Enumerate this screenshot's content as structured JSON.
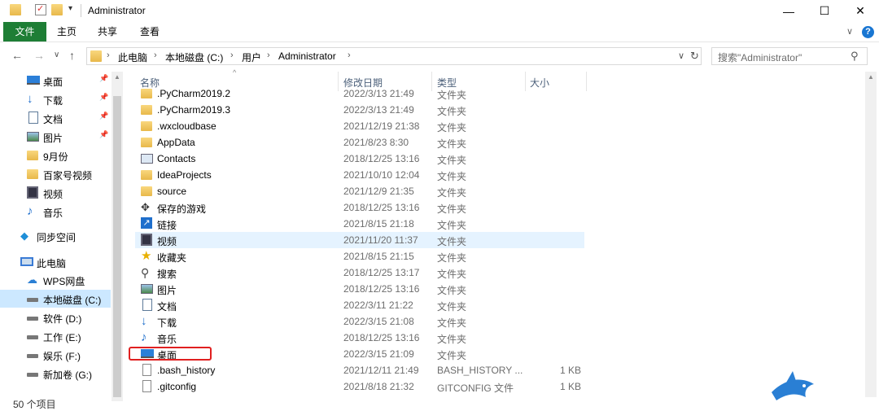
{
  "window": {
    "title": "Administrator"
  },
  "ribbon": {
    "tabs": [
      "文件",
      "主页",
      "共享",
      "查看"
    ]
  },
  "address": {
    "crumbs": [
      "此电脑",
      "本地磁盘 (C:)",
      "用户",
      "Administrator"
    ],
    "search_placeholder": "搜索\"Administrator\""
  },
  "nav": {
    "items": [
      {
        "label": "桌面",
        "icon": "desktop-icon",
        "pinned": true
      },
      {
        "label": "下载",
        "icon": "download-icon",
        "pinned": true
      },
      {
        "label": "文档",
        "icon": "document-icon",
        "pinned": true
      },
      {
        "label": "图片",
        "icon": "picture-icon",
        "pinned": true
      },
      {
        "label": "9月份",
        "icon": "folder-icon",
        "pinned": false
      },
      {
        "label": "百家号视频",
        "icon": "folder-icon",
        "pinned": false
      },
      {
        "label": "视频",
        "icon": "video-icon",
        "pinned": false
      },
      {
        "label": "音乐",
        "icon": "music-icon",
        "pinned": false
      },
      {
        "label": "同步空间",
        "icon": "sync-icon",
        "pinned": false
      },
      {
        "label": "此电脑",
        "icon": "computer-icon",
        "pinned": false
      },
      {
        "label": "WPS网盘",
        "icon": "cloud-icon",
        "pinned": false
      },
      {
        "label": "本地磁盘 (C:)",
        "icon": "drive-icon",
        "pinned": false,
        "selected": true
      },
      {
        "label": "软件 (D:)",
        "icon": "drive-icon",
        "pinned": false
      },
      {
        "label": "工作 (E:)",
        "icon": "drive-icon",
        "pinned": false
      },
      {
        "label": "娱乐 (F:)",
        "icon": "drive-icon",
        "pinned": false
      },
      {
        "label": "新加卷 (G:)",
        "icon": "drive-icon",
        "pinned": false
      }
    ]
  },
  "columns": {
    "name": "名称",
    "date": "修改日期",
    "type": "类型",
    "size": "大小"
  },
  "files": [
    {
      "name": ".PyCharm2019.2",
      "date": "2022/3/13 21:49",
      "type": "文件夹",
      "size": "",
      "icon": "folder-icon"
    },
    {
      "name": ".PyCharm2019.3",
      "date": "2022/3/13 21:49",
      "type": "文件夹",
      "size": "",
      "icon": "folder-icon"
    },
    {
      "name": ".wxcloudbase",
      "date": "2021/12/19 21:38",
      "type": "文件夹",
      "size": "",
      "icon": "folder-icon"
    },
    {
      "name": "AppData",
      "date": "2021/8/23 8:30",
      "type": "文件夹",
      "size": "",
      "icon": "folder-icon"
    },
    {
      "name": "Contacts",
      "date": "2018/12/25 13:16",
      "type": "文件夹",
      "size": "",
      "icon": "contacts-icon"
    },
    {
      "name": "IdeaProjects",
      "date": "2021/10/10 12:04",
      "type": "文件夹",
      "size": "",
      "icon": "folder-icon"
    },
    {
      "name": "source",
      "date": "2021/12/9 21:35",
      "type": "文件夹",
      "size": "",
      "icon": "folder-icon"
    },
    {
      "name": "保存的游戏",
      "date": "2018/12/25 13:16",
      "type": "文件夹",
      "size": "",
      "icon": "saved-games-icon"
    },
    {
      "name": "链接",
      "date": "2021/8/15 21:18",
      "type": "文件夹",
      "size": "",
      "icon": "links-icon"
    },
    {
      "name": "视频",
      "date": "2021/11/20 11:37",
      "type": "文件夹",
      "size": "",
      "icon": "video-icon"
    },
    {
      "name": "收藏夹",
      "date": "2021/8/15 21:15",
      "type": "文件夹",
      "size": "",
      "icon": "favorites-icon"
    },
    {
      "name": "搜索",
      "date": "2018/12/25 13:17",
      "type": "文件夹",
      "size": "",
      "icon": "search-icon"
    },
    {
      "name": "图片",
      "date": "2018/12/25 13:16",
      "type": "文件夹",
      "size": "",
      "icon": "picture-icon"
    },
    {
      "name": "文档",
      "date": "2022/3/11 21:22",
      "type": "文件夹",
      "size": "",
      "icon": "document-icon"
    },
    {
      "name": "下载",
      "date": "2022/3/15 21:08",
      "type": "文件夹",
      "size": "",
      "icon": "download-icon"
    },
    {
      "name": "音乐",
      "date": "2018/12/25 13:16",
      "type": "文件夹",
      "size": "",
      "icon": "music-icon"
    },
    {
      "name": "桌面",
      "date": "2022/3/15 21:09",
      "type": "文件夹",
      "size": "",
      "icon": "desktop-icon"
    },
    {
      "name": ".bash_history",
      "date": "2021/12/11 21:49",
      "type": "BASH_HISTORY ...",
      "size": "1 KB",
      "icon": "file-icon"
    },
    {
      "name": ".gitconfig",
      "date": "2021/8/18 21:32",
      "type": "GITCONFIG 文件",
      "size": "1 KB",
      "icon": "file-icon"
    }
  ],
  "status": {
    "count_text": "50 个项目"
  },
  "colors": {
    "file_tab": "#1e7e35",
    "selection": "#cce8ff",
    "hover": "#e5f3ff",
    "highlight_box": "#e02020"
  }
}
